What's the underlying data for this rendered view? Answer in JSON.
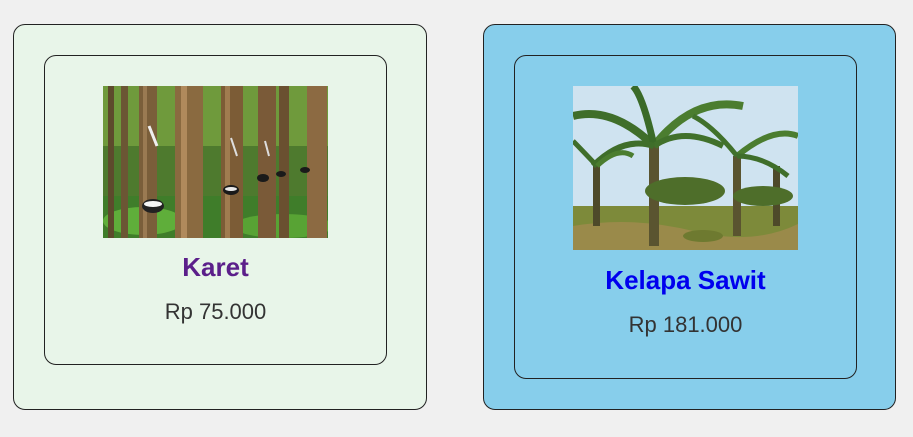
{
  "products": [
    {
      "title": "Karet",
      "price": "Rp 75.000",
      "image": "rubber-plantation-photo",
      "title_color": "#5b1f8a",
      "card_bg": "#e8f5e9"
    },
    {
      "title": "Kelapa Sawit",
      "price": "Rp 181.000",
      "image": "oil-palm-plantation-photo",
      "title_color": "#0000ee",
      "card_bg": "#87ceeb"
    }
  ]
}
